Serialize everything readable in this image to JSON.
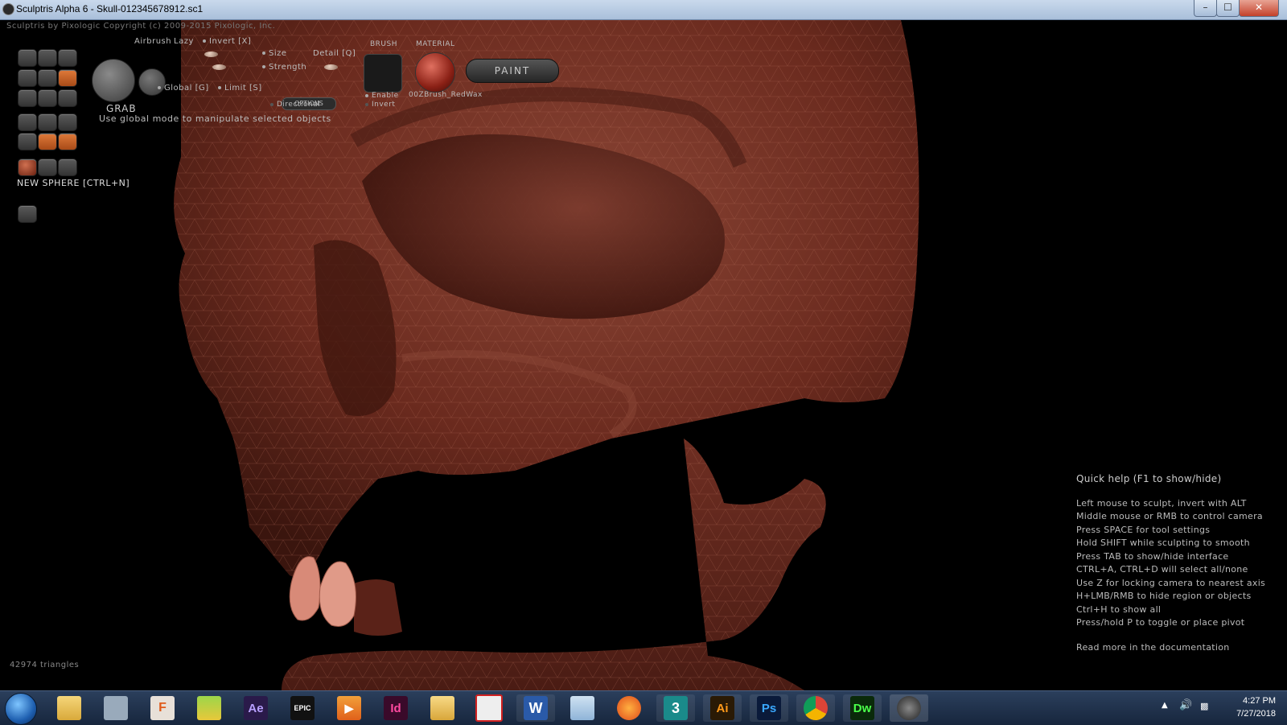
{
  "window": {
    "title": "Sculptris Alpha 6 - Skull-012345678912.sc1",
    "minimize": "–",
    "maximize": "☐",
    "close": "✕"
  },
  "infoline": "Sculptris by Pixologic   Copyright (c) 2009-2015 Pixologic, Inc.",
  "tool": {
    "grab_label": "GRAB",
    "airbrush": "Airbrush",
    "lazy": "Lazy",
    "invert": "Invert [X]",
    "size": "Size",
    "detail": "Detail [Q]",
    "strength": "Strength",
    "global": "Global [G]",
    "limit": "Limit [S]",
    "options": "OPTIONS",
    "directional": "Directional",
    "hint": "Use global mode to manipulate selected objects"
  },
  "brush": {
    "label": "BRUSH",
    "enable": "Enable",
    "invert": "Invert"
  },
  "material": {
    "label": "MATERIAL",
    "name": "00ZBrush_RedWax"
  },
  "paint_button": "PAINT",
  "new_sphere": "NEW SPHERE [CTRL+N]",
  "quickhelp": {
    "title": "Quick help (F1 to show/hide)",
    "lines": [
      "Left mouse to sculpt, invert with ALT",
      "Middle mouse or RMB to control camera",
      "Press SPACE for tool settings",
      "Hold SHIFT while sculpting to smooth",
      "Press TAB to show/hide interface",
      "CTRL+A, CTRL+D will select all/none",
      "Use Z for locking camera to nearest axis",
      "H+LMB/RMB to hide region or objects",
      "Ctrl+H to show all",
      "Press/hold P to toggle or place pivot"
    ],
    "more": "Read more in the documentation"
  },
  "triangle_count": "42974 triangles",
  "taskbar": {
    "apps": [
      {
        "name": "file-explorer",
        "label": ""
      },
      {
        "name": "3d-builder",
        "label": ""
      },
      {
        "name": "flash",
        "label": "F"
      },
      {
        "name": "photos",
        "label": ""
      },
      {
        "name": "after-effects",
        "label": "Ae"
      },
      {
        "name": "epic-games",
        "label": "EPIC"
      },
      {
        "name": "media-player",
        "label": "▶"
      },
      {
        "name": "indesign",
        "label": "Id"
      },
      {
        "name": "folder",
        "label": ""
      },
      {
        "name": "acrobat",
        "label": ""
      },
      {
        "name": "word",
        "label": "W"
      },
      {
        "name": "image-viewer",
        "label": ""
      },
      {
        "name": "firefox",
        "label": ""
      },
      {
        "name": "3ds-max",
        "label": "3"
      },
      {
        "name": "illustrator",
        "label": "Ai"
      },
      {
        "name": "photoshop",
        "label": "Ps"
      },
      {
        "name": "chrome",
        "label": ""
      },
      {
        "name": "dreamweaver",
        "label": "Dw"
      },
      {
        "name": "sculptris",
        "label": ""
      }
    ],
    "time": "4:27 PM",
    "date": "7/27/2018"
  },
  "colors": {
    "skull": "#6a2a1e",
    "skull_light": "#8a4535",
    "teeth": "#d88a78",
    "accent_orange": "#d06a2a"
  }
}
